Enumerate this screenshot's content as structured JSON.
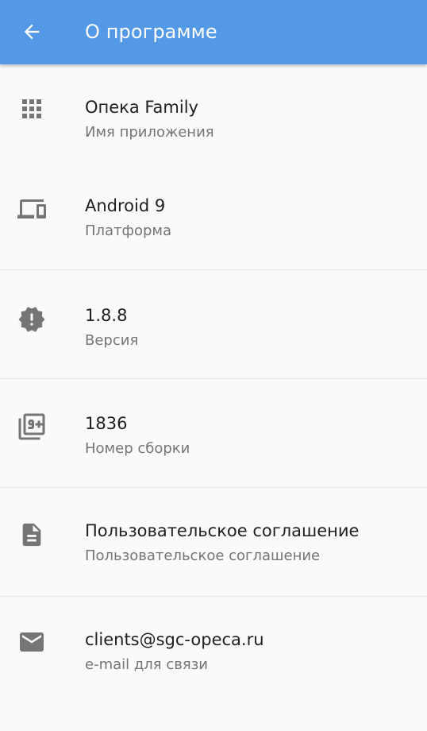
{
  "appbar": {
    "title": "О программе",
    "back_icon": "arrow-back-icon",
    "color": "#5499e6"
  },
  "items": [
    {
      "title": "Опека Family",
      "subtitle": "Имя приложения",
      "icon": "apps-grid-icon"
    },
    {
      "title": "Android 9",
      "subtitle": "Платформа",
      "icon": "devices-icon"
    },
    {
      "title": "1.8.8",
      "subtitle": "Версия",
      "icon": "new-releases-icon"
    },
    {
      "title": "1836",
      "subtitle": "Номер сборки",
      "icon": "filter-9-plus-icon"
    },
    {
      "title": "Пользовательское соглашение",
      "subtitle": "Пользовательское соглашение",
      "icon": "document-icon"
    },
    {
      "title": "clients@sgc-opeca.ru",
      "subtitle": "e-mail для связи",
      "icon": "email-icon"
    }
  ],
  "colors": {
    "icon_gray": "#757575",
    "title_text": "#202020",
    "subtitle_text": "#757575",
    "background": "#fafafa"
  }
}
